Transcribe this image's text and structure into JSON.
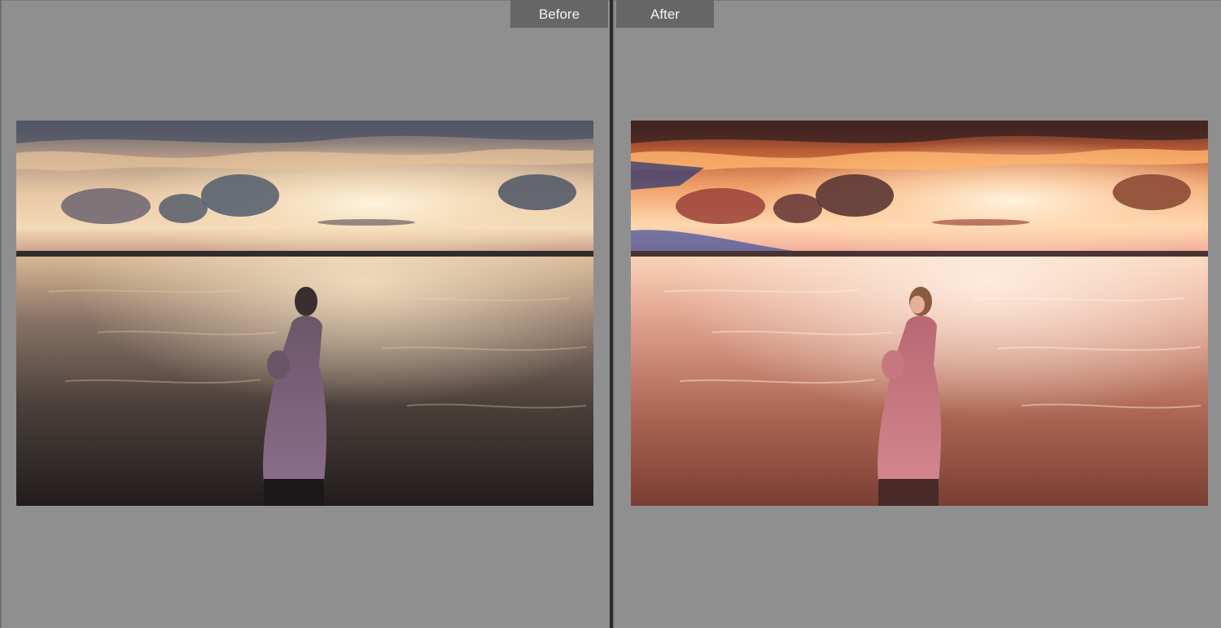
{
  "compare": {
    "before_label": "Before",
    "after_label": "After"
  },
  "images": {
    "before": {
      "icon": "sunset-lake-photo",
      "tone": "dark-muted",
      "sky_top": "#5a5f6e",
      "sky_glow": "#f5e3c4",
      "water_dark": "#25211f",
      "dress": "#8c6f8e"
    },
    "after": {
      "icon": "sunset-lake-photo",
      "tone": "warm-bright",
      "sky_top": "#4a2a2a",
      "sky_glow": "#fff1d8",
      "water_dark": "#8a4a3c",
      "dress": "#c9787f"
    }
  }
}
